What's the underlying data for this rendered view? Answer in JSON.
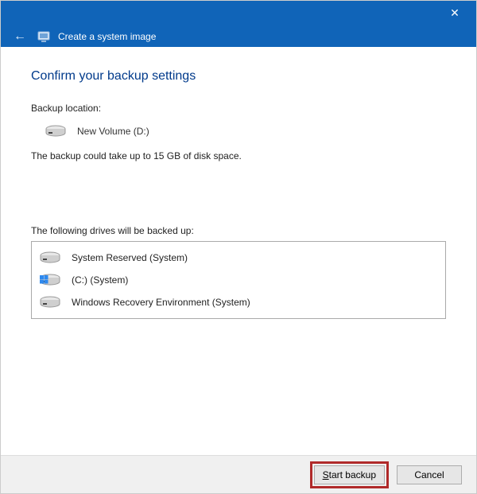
{
  "titlebar": {
    "window_title": "Create a system image"
  },
  "page": {
    "heading": "Confirm your backup settings",
    "backup_location_label": "Backup location:",
    "backup_location_value": "New Volume (D:)",
    "size_estimate": "The backup could take up to 15 GB of disk space.",
    "drives_label": "The following drives will be backed up:",
    "drives": [
      {
        "icon": "drive",
        "label": "System Reserved (System)"
      },
      {
        "icon": "windows",
        "label": "(C:) (System)"
      },
      {
        "icon": "drive",
        "label": "Windows Recovery Environment (System)"
      }
    ]
  },
  "footer": {
    "start_label": "Start backup",
    "cancel_label": "Cancel"
  }
}
